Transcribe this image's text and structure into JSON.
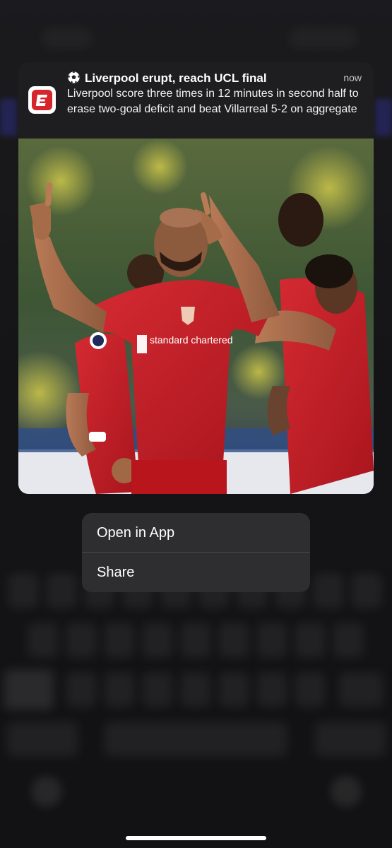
{
  "notification": {
    "app_name": "ESPN",
    "title": "Liverpool erupt, reach UCL final",
    "time": "now",
    "body": "Liverpool score three times in 12 minutes in second half to erase two-goal deficit and beat Villarreal 5-2 on aggregate",
    "icon": "soccer-ball-icon",
    "app_icon": "espn-logo-icon",
    "photo": {
      "jersey_sponsor": "standard chartered"
    }
  },
  "menu": {
    "open_label": "Open in App",
    "share_label": "Share"
  },
  "colors": {
    "espn_red": "#d7252c",
    "liverpool_red": "#c8102e",
    "menu_bg": "#2e2e31",
    "card_bg": "#1e1e20"
  }
}
